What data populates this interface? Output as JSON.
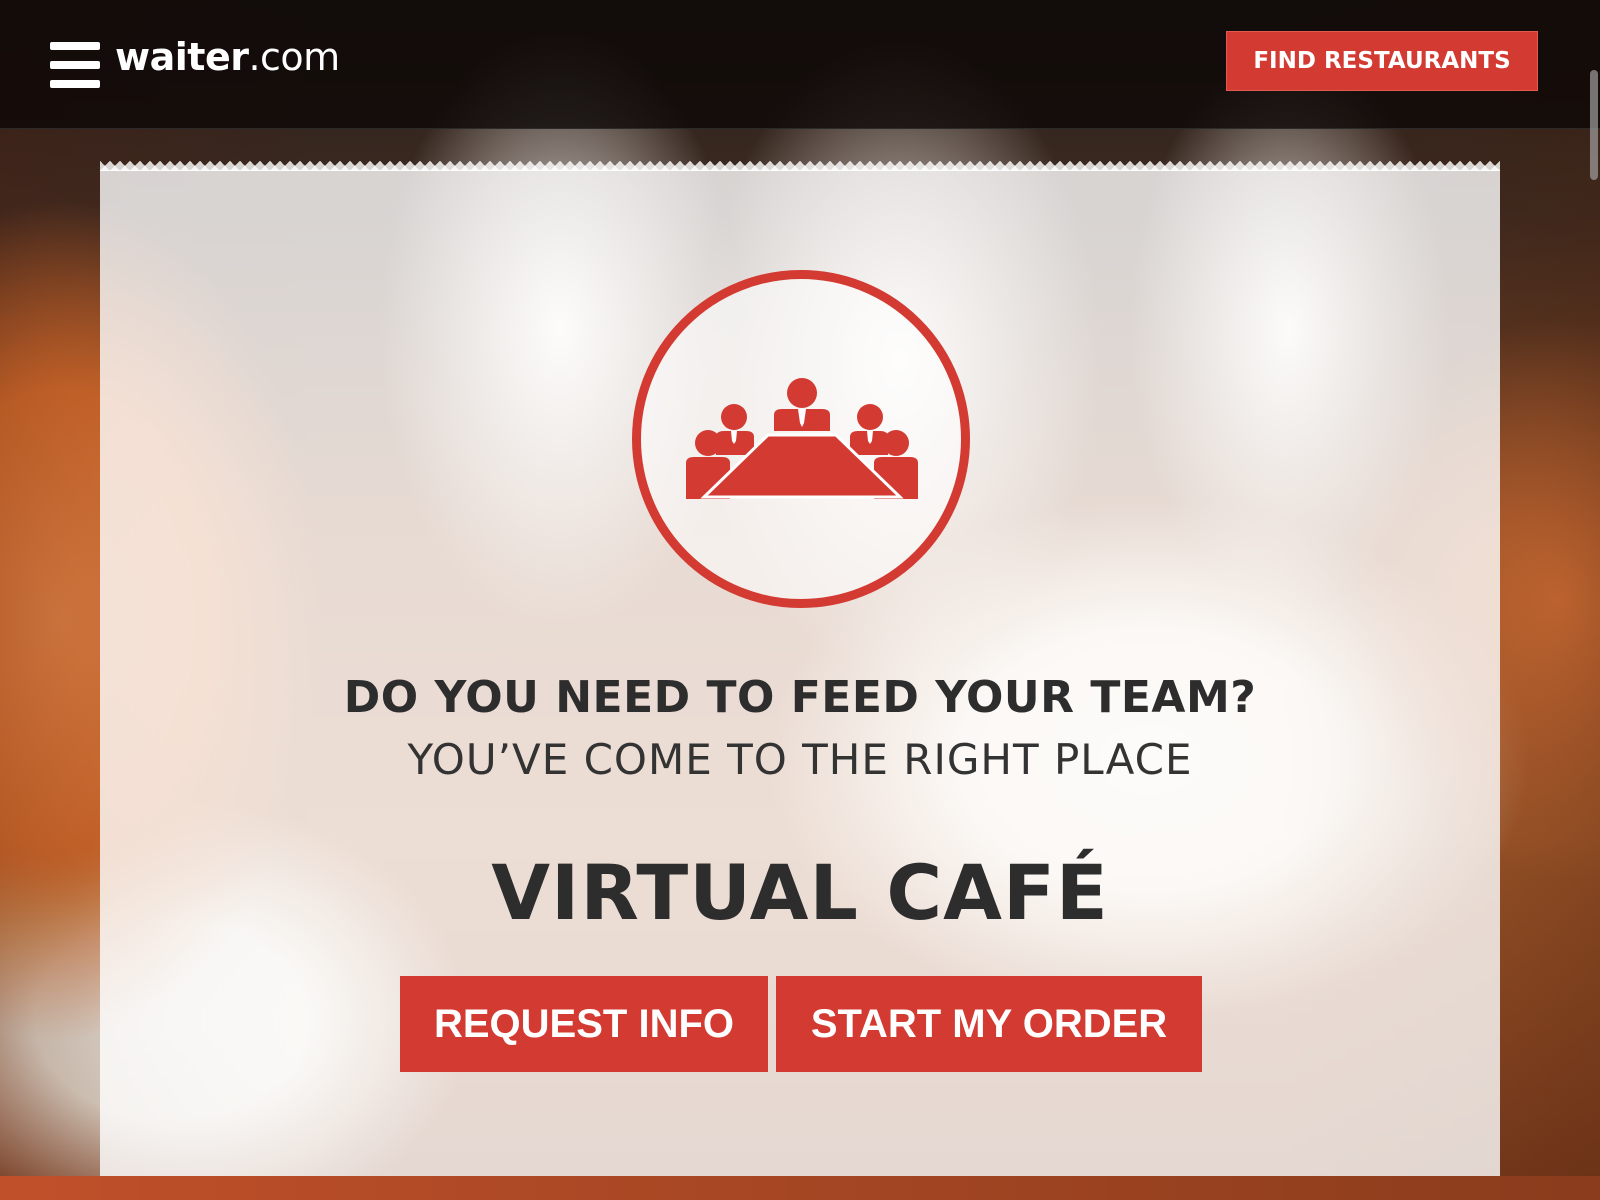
{
  "header": {
    "logo_name": "waiter",
    "logo_tld": ".com",
    "find_restaurants_label": "FIND RESTAURANTS"
  },
  "hero": {
    "headline": "DO YOU NEED TO FEED YOUR TEAM?",
    "subheadline": "YOU’VE COME TO THE RIGHT PLACE",
    "product_title": "VIRTUAL CAFÉ",
    "request_info_label": "REQUEST INFO",
    "start_order_label": "START MY ORDER",
    "icon": "meeting-table-icon"
  },
  "colors": {
    "accent": "#d33a32",
    "text_dark": "#2d2d2d"
  }
}
